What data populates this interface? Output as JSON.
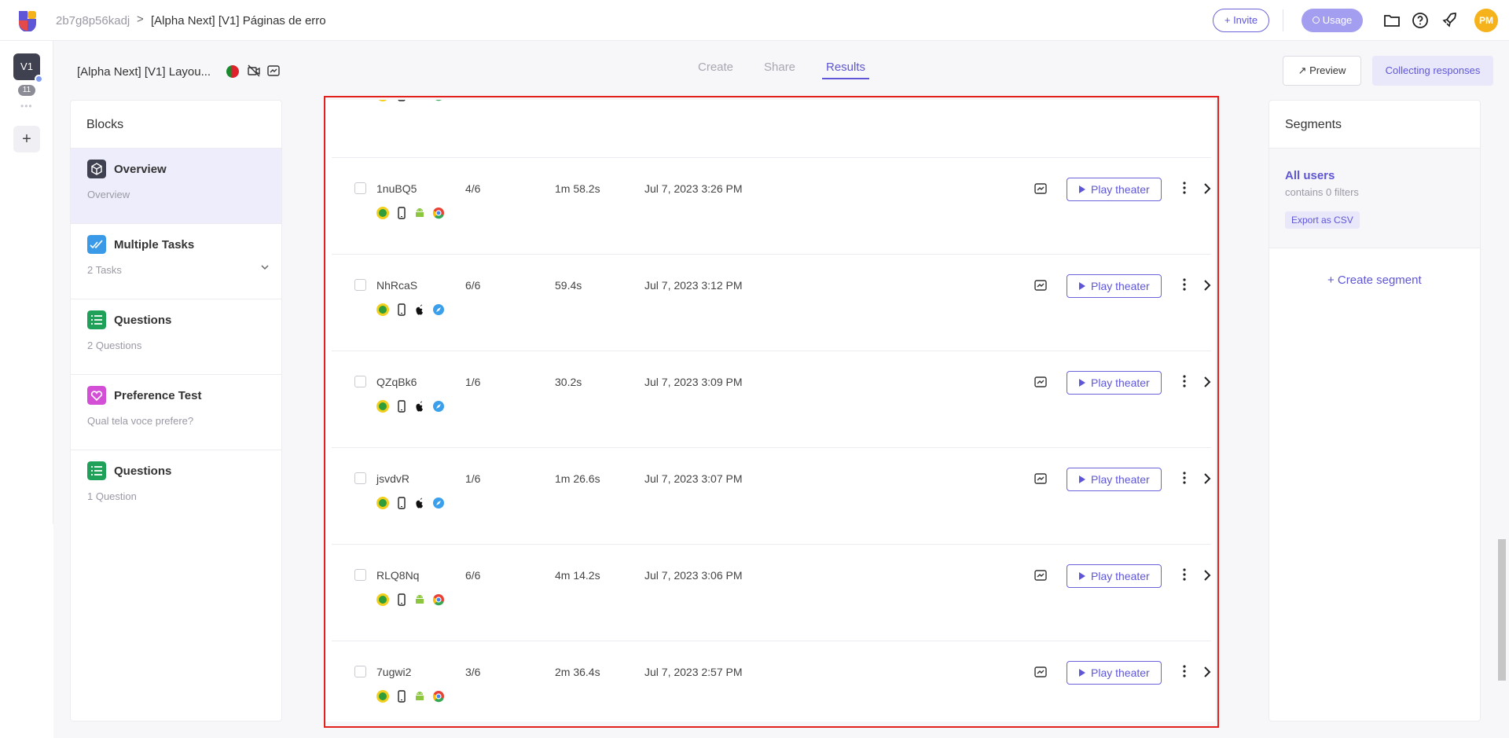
{
  "header": {
    "crumb_root": "2b7g8p56kadj",
    "crumb_sep": ">",
    "crumb_title": "[Alpha Next] [V1] Páginas de erro",
    "invite_label": "+ Invite",
    "usage_label": "Usage",
    "avatar_initials": "PM"
  },
  "rail": {
    "version": "V1",
    "count": "11",
    "dots": "•••",
    "add": "+"
  },
  "subheader": {
    "study_name": "[Alpha Next] [V1] Layou...",
    "tabs": [
      "Create",
      "Share",
      "Results"
    ],
    "active_tab": "Results",
    "preview_label": "Preview",
    "collecting_label": "Collecting responses"
  },
  "blocks": {
    "title": "Blocks",
    "items": [
      {
        "name": "Overview",
        "sub": "Overview",
        "icon": "cube-icon",
        "color": "#3f4150"
      },
      {
        "name": "Multiple Tasks",
        "sub": "2 Tasks",
        "icon": "double-check-icon",
        "color": "#3b9ae8"
      },
      {
        "name": "Questions",
        "sub": "2 Questions",
        "icon": "list-icon",
        "color": "#1fa15a"
      },
      {
        "name": "Preference Test",
        "sub": "Qual tela voce prefere?",
        "icon": "heart-icon",
        "color": "#d24fd6"
      },
      {
        "name": "Questions",
        "sub": "1 Question",
        "icon": "list-icon",
        "color": "#1fa15a"
      }
    ]
  },
  "results": {
    "play_label": "Play theater",
    "rows": [
      {
        "id": "1nuBQ5",
        "score": "4/6",
        "duration": "1m 58.2s",
        "date": "Jul 7, 2023 3:26 PM",
        "os": "android"
      },
      {
        "id": "NhRcaS",
        "score": "6/6",
        "duration": "59.4s",
        "date": "Jul 7, 2023 3:12 PM",
        "os": "apple"
      },
      {
        "id": "QZqBk6",
        "score": "1/6",
        "duration": "30.2s",
        "date": "Jul 7, 2023 3:09 PM",
        "os": "apple"
      },
      {
        "id": "jsvdvR",
        "score": "1/6",
        "duration": "1m 26.6s",
        "date": "Jul 7, 2023 3:07 PM",
        "os": "apple"
      },
      {
        "id": "RLQ8Nq",
        "score": "6/6",
        "duration": "4m 14.2s",
        "date": "Jul 7, 2023 3:06 PM",
        "os": "android"
      },
      {
        "id": "7ugwi2",
        "score": "3/6",
        "duration": "2m 36.4s",
        "date": "Jul 7, 2023 2:57 PM",
        "os": "android"
      }
    ]
  },
  "segments": {
    "title": "Segments",
    "all_users": "All users",
    "filters": "contains 0 filters",
    "export_label": "Export as CSV",
    "create_label": "+ Create segment"
  },
  "colors": {
    "accent": "#5e56d6",
    "highlight": "#e2201c"
  }
}
